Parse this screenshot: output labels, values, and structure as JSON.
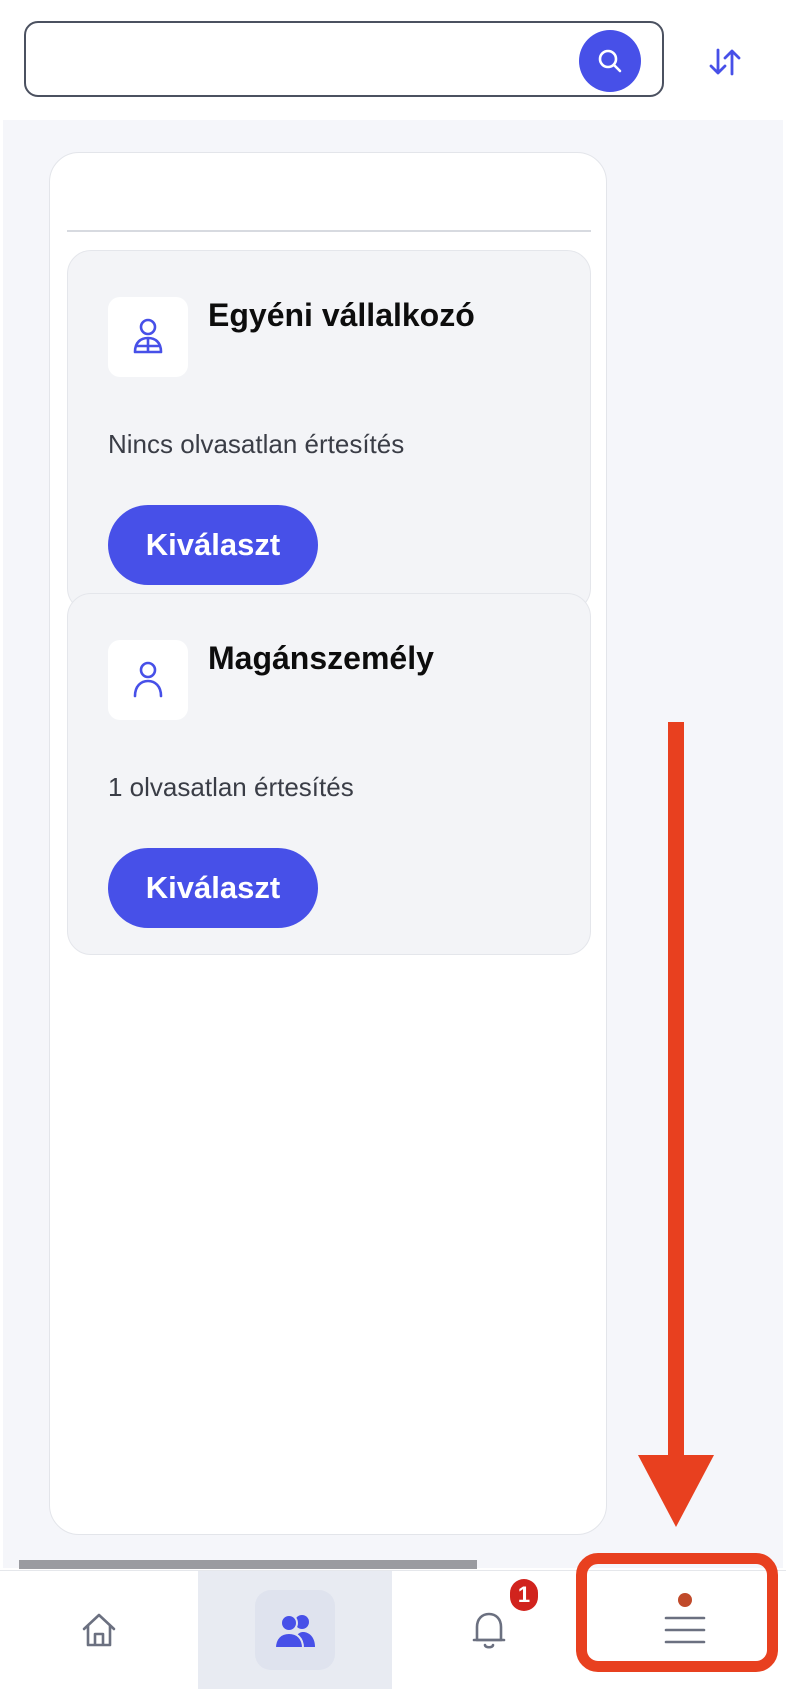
{
  "search": {
    "value": "",
    "placeholder": ""
  },
  "icons": {
    "search": "search-icon",
    "sort": "sort-arrows-icon",
    "business_account": "business-person-icon",
    "personal_account": "person-icon",
    "home": "home-icon",
    "accounts": "users-icon",
    "notifications": "bell-icon",
    "menu": "hamburger-menu-icon"
  },
  "accounts": [
    {
      "title": "Egyéni vállalkozó",
      "status": "Nincs olvasatlan értesítés",
      "button_label": "Kiválaszt"
    },
    {
      "title": "Magánszemély",
      "status": "1 olvasatlan értesítés",
      "button_label": "Kiválaszt"
    }
  ],
  "bottom_nav": {
    "active": "accounts",
    "notification_badge": "1"
  },
  "colors": {
    "accent": "#4750e8",
    "badge": "#d1231d",
    "annotation": "#e8401f"
  }
}
